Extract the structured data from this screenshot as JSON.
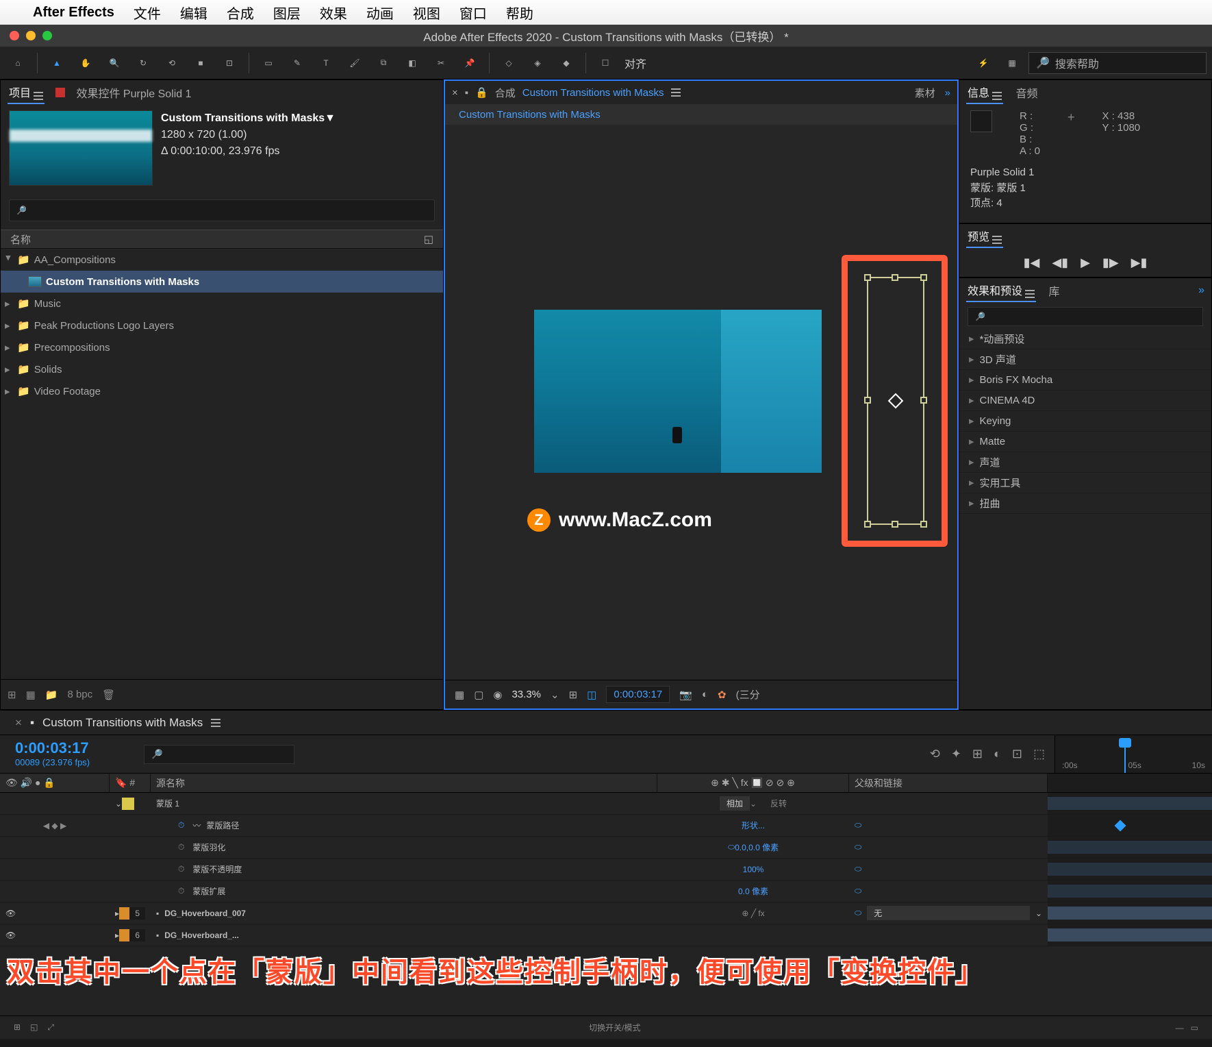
{
  "menubar": {
    "app": "After Effects",
    "items": [
      "文件",
      "编辑",
      "合成",
      "图层",
      "效果",
      "动画",
      "视图",
      "窗口",
      "帮助"
    ]
  },
  "window_title": "Adobe After Effects 2020 - Custom Transitions with Masks（已转换） *",
  "toolbar": {
    "align": "对齐",
    "search_placeholder": "搜索帮助"
  },
  "project": {
    "tab": "项目",
    "fx_tab": "效果控件 Purple Solid 1",
    "comp_title": "Custom Transitions with Masks▼",
    "dims": "1280 x 720 (1.00)",
    "dur": "Δ 0:00:10:00, 23.976 fps",
    "name_col": "名称",
    "tree": [
      {
        "label": "AA_Compositions",
        "expanded": true,
        "children": [
          {
            "label": "Custom Transitions with Masks",
            "selected": true
          }
        ]
      },
      {
        "label": "Music"
      },
      {
        "label": "Peak Productions Logo Layers"
      },
      {
        "label": "Precompositions"
      },
      {
        "label": "Solids"
      },
      {
        "label": "Video Footage"
      }
    ],
    "bpc": "8 bpc"
  },
  "composition": {
    "tab_prefix": "合成",
    "tab_name": "Custom Transitions with Masks",
    "footage_tab": "素材",
    "crumb": "Custom Transitions with Masks",
    "watermark": "www.MacZ.com",
    "footer": {
      "zoom": "33.3%",
      "time": "0:00:03:17",
      "res": "(三分"
    }
  },
  "info": {
    "tab": "信息",
    "audio_tab": "音频",
    "r": "R :",
    "g": "G :",
    "b": "B :",
    "a": "A :  0",
    "x": "X : 438",
    "y": "Y : 1080",
    "sel_layer": "Purple Solid 1",
    "sel_mask": "蒙版: 蒙版 1",
    "sel_vert": "顶点: 4"
  },
  "preview": {
    "tab": "预览"
  },
  "effects": {
    "tab": "效果和预设",
    "lib_tab": "库",
    "items": [
      "*动画预设",
      "3D 声道",
      "Boris FX Mocha",
      "CINEMA 4D",
      "Keying",
      "Matte",
      "声道",
      "实用工具",
      "扭曲"
    ]
  },
  "timeline": {
    "tab": "Custom Transitions with Masks",
    "time": "0:00:03:17",
    "frames": "00089 (23.976 fps)",
    "cols": {
      "name": "源名称",
      "switches": "⊕ ✱ ╲ fx 🔲 ⊘ ⊘ ⊕",
      "parent": "父级和链接"
    },
    "ruler": [
      ":00s",
      "05s",
      "10s"
    ],
    "rows": {
      "mask": {
        "name": "蒙版 1",
        "mode": "相加",
        "invert": "反转"
      },
      "path": {
        "label": "蒙版路径",
        "value": "形状..."
      },
      "feather": {
        "label": "蒙版羽化",
        "value": "0.0,0.0 像素"
      },
      "opacity": {
        "label": "蒙版不透明度",
        "value": "100%"
      },
      "expansion": {
        "label": "蒙版扩展",
        "value": "0.0 像素"
      },
      "layer5": {
        "num": "5",
        "name": "DG_Hoverboard_007",
        "parent": "无"
      },
      "layer6": {
        "num": "6",
        "name": "DG_Hoverboard_..."
      }
    },
    "footer_center": "切换开关/模式"
  },
  "annotation": "双击其中一个点在「蒙版」中间看到这些控制手柄时，便可使用「变换控件」"
}
